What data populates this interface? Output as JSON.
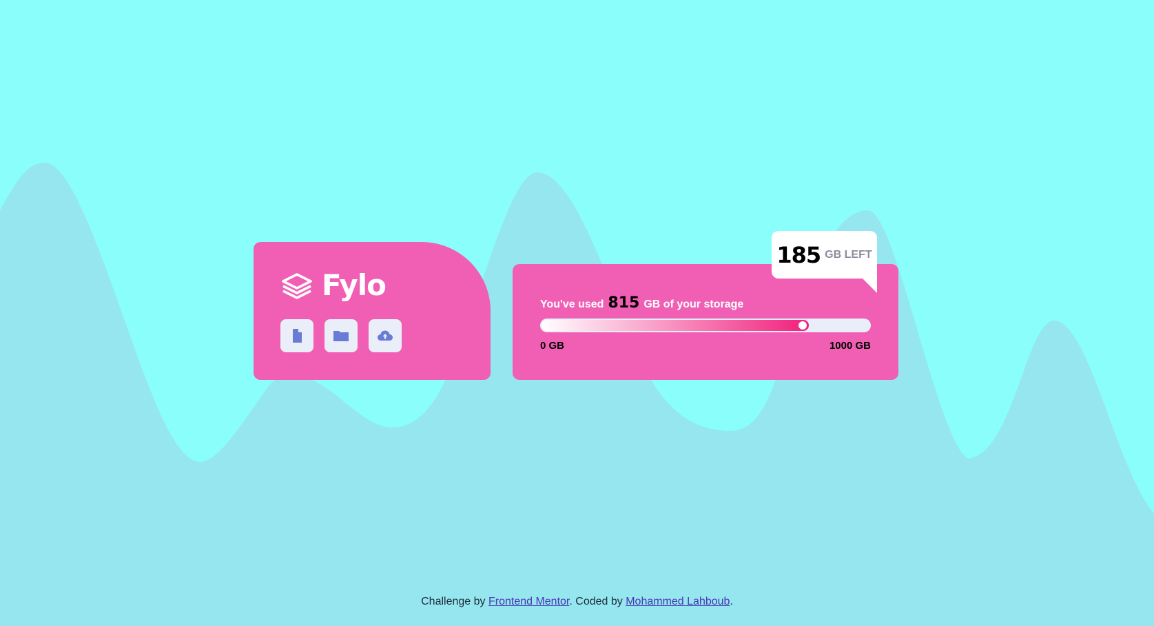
{
  "brand": {
    "name": "Fylo",
    "logo_icon": "stacked-layers-icon"
  },
  "actions": [
    {
      "icon": "document-icon"
    },
    {
      "icon": "folder-icon"
    },
    {
      "icon": "cloud-upload-icon"
    }
  ],
  "storage": {
    "used_prefix": "You've used",
    "used_value": "815",
    "used_suffix": "GB of your storage",
    "min_label": "0 GB",
    "max_label": "1000 GB",
    "used_fraction": 0.815,
    "left_value": "185",
    "left_label": "GB LEFT"
  },
  "attribution": {
    "prefix": "Challenge by",
    "link1": "Frontend Mentor",
    "middle": ". Coded by",
    "link2": "Mohammed Lahboub",
    "suffix": "."
  },
  "colors": {
    "background": "#8afefb",
    "wave": "#95e6ef",
    "card": "#f15fb5",
    "button_bg": "#e9eef9",
    "icon": "#6a7bd6",
    "progress_end": "#f11f7c"
  }
}
